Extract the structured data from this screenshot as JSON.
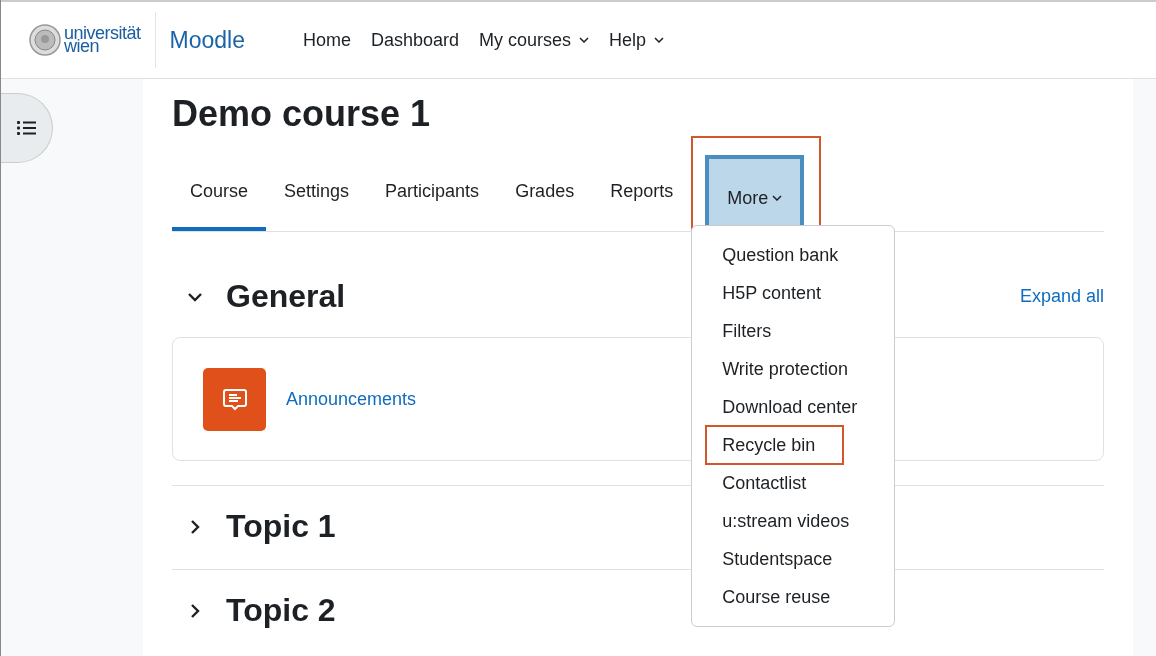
{
  "header": {
    "logo_text": [
      "universität",
      "wien"
    ],
    "site_name": "Moodle",
    "nav": [
      {
        "label": "Home",
        "dropdown": false
      },
      {
        "label": "Dashboard",
        "dropdown": false
      },
      {
        "label": "My courses",
        "dropdown": true
      },
      {
        "label": "Help",
        "dropdown": true
      }
    ]
  },
  "course": {
    "title": "Demo course 1"
  },
  "tabs": [
    {
      "label": "Course",
      "selected": true,
      "dropdown": false,
      "highlighted": false
    },
    {
      "label": "Settings",
      "selected": false,
      "dropdown": false,
      "highlighted": false
    },
    {
      "label": "Participants",
      "selected": false,
      "dropdown": false,
      "highlighted": false
    },
    {
      "label": "Grades",
      "selected": false,
      "dropdown": false,
      "highlighted": false
    },
    {
      "label": "Reports",
      "selected": false,
      "dropdown": false,
      "highlighted": false
    },
    {
      "label": "More",
      "selected": false,
      "dropdown": true,
      "highlighted": true
    }
  ],
  "more_menu": [
    {
      "label": "Question bank",
      "highlighted": false
    },
    {
      "label": "H5P content",
      "highlighted": false
    },
    {
      "label": "Filters",
      "highlighted": false
    },
    {
      "label": "Write protection",
      "highlighted": false
    },
    {
      "label": "Download center",
      "highlighted": false
    },
    {
      "label": "Recycle bin",
      "highlighted": true
    },
    {
      "label": "Contactlist",
      "highlighted": false
    },
    {
      "label": "u:stream videos",
      "highlighted": false
    },
    {
      "label": "Studentspace",
      "highlighted": false
    },
    {
      "label": "Course reuse",
      "highlighted": false
    }
  ],
  "expand_all": "Expand all",
  "sections": [
    {
      "title": "General",
      "expanded": true,
      "activities": [
        {
          "name": "Announcements"
        }
      ]
    },
    {
      "title": "Topic 1",
      "expanded": false
    },
    {
      "title": "Topic 2",
      "expanded": false
    }
  ]
}
